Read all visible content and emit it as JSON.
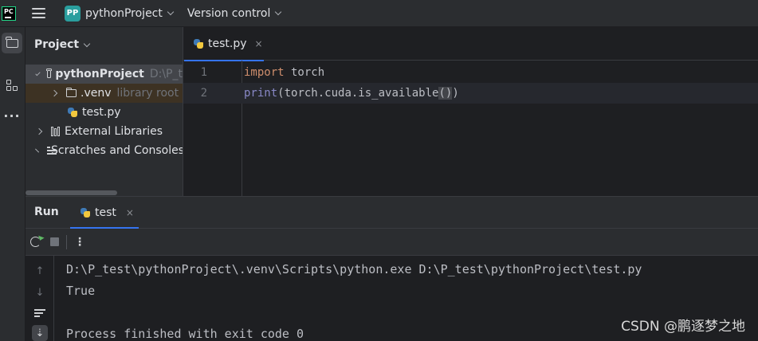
{
  "titlebar": {
    "app_logo": "PC",
    "project_badge": "PP",
    "project_name": "pythonProject",
    "version_control": "Version control"
  },
  "project_panel": {
    "title": "Project",
    "tree": [
      {
        "label": "pythonProject",
        "hint": "D:\\P_t"
      },
      {
        "label": ".venv",
        "hint": "library root"
      },
      {
        "label": "test.py"
      },
      {
        "label": "External Libraries"
      },
      {
        "label": "Scratches and Consoles"
      }
    ]
  },
  "editor": {
    "tab": "test.py",
    "tab_close": "×",
    "lines": [
      {
        "num": "1",
        "keyword": "import",
        "rest": " torch"
      },
      {
        "num": "2",
        "builtin": "print",
        "pre": "(torch.cuda.is_available",
        "paren": "()",
        "post": ")"
      }
    ]
  },
  "run_panel": {
    "title": "Run",
    "tab": "test",
    "tab_close": "×",
    "kebab": "⋮",
    "console": [
      "D:\\P_test\\pythonProject\\.venv\\Scripts\\python.exe D:\\P_test\\pythonProject\\test.py",
      "True",
      "",
      "Process finished with exit code 0"
    ]
  },
  "watermark": "CSDN @鹏逐梦之地",
  "icons": {
    "up": "↑",
    "down": "↓",
    "scroll_end": "⇣"
  },
  "colors": {
    "keyword": "#cf8e6d",
    "builtin": "#8888c6",
    "accent": "#3574f0",
    "project_badge": "#2a9e9e"
  }
}
